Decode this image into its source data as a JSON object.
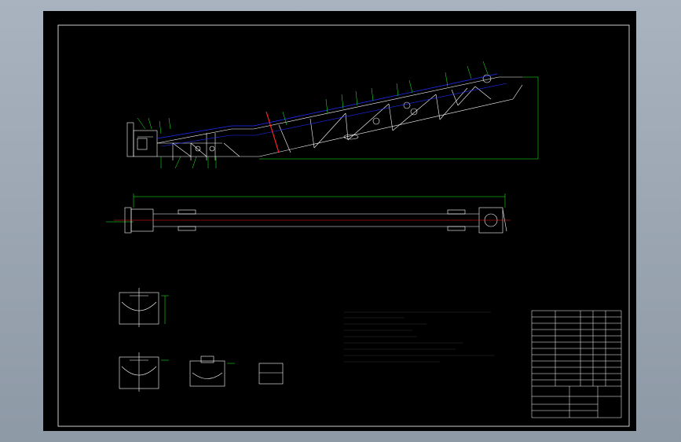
{
  "notes": {
    "title": "",
    "lines": []
  },
  "title_block": {
    "drawing_name": "",
    "rows": []
  },
  "colors": {
    "frame": "#ffffff",
    "structure": "#ffffff",
    "belt": "#1e2cff",
    "centerline": "#ff2020",
    "dimension": "#20ff20",
    "background": "#000000"
  }
}
